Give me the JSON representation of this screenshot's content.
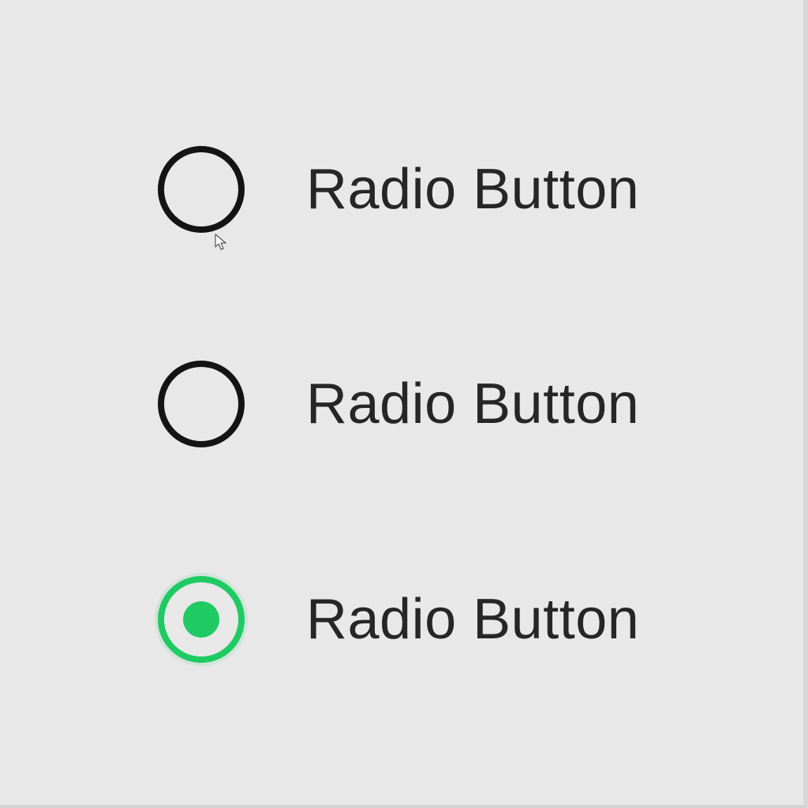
{
  "radio_group": {
    "accent_color": "#1fca63",
    "options": [
      {
        "label": "Radio Button",
        "checked": false
      },
      {
        "label": "Radio Button",
        "checked": false
      },
      {
        "label": "Radio Button",
        "checked": true
      }
    ]
  },
  "cursor": {
    "icon": "mouse-pointer-icon"
  }
}
